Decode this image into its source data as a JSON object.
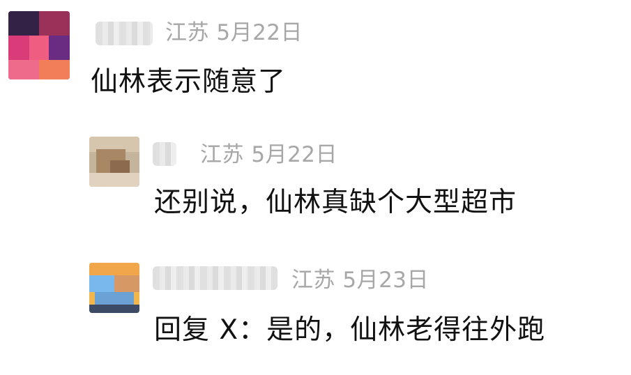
{
  "comments": [
    {
      "location": "江苏",
      "date": "5月22日",
      "text": "仙林表示随意了"
    },
    {
      "location": "江苏",
      "date": "5月22日",
      "text": "还别说，仙林真缺个大型超市"
    },
    {
      "location": "江苏",
      "date": "5月23日",
      "text": "回复 X：是的，仙林老得往外跑"
    }
  ]
}
